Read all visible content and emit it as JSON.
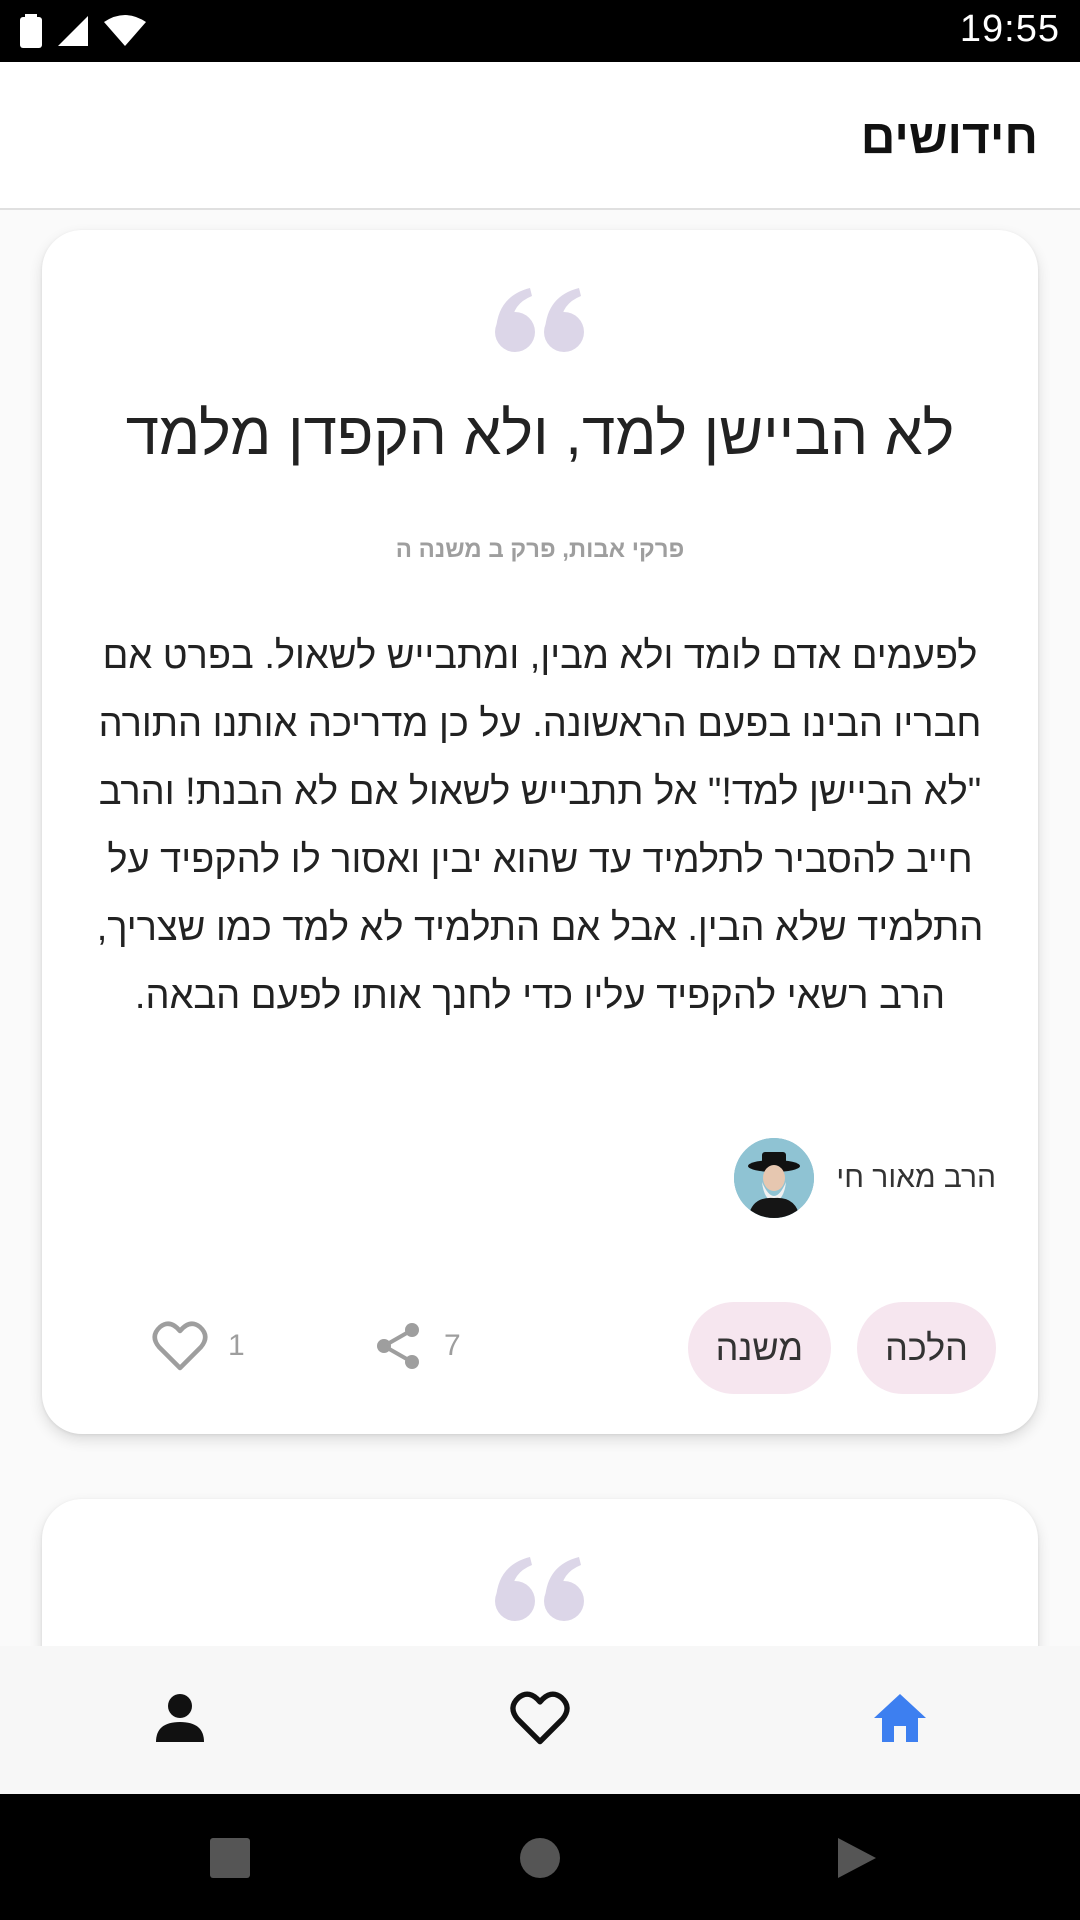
{
  "status_bar": {
    "time": "19:55",
    "icons": [
      "battery-icon",
      "signal-icon",
      "wifi-icon"
    ]
  },
  "app_bar": {
    "title": "חידושים"
  },
  "cards": [
    {
      "title": "לא הביישן למד, ולא הקפדן מלמד",
      "source": "פרקי אבות, פרק ב משנה ה",
      "body": "לפעמים אדם לומד ולא מבין, ומתבייש לשאול. בפרט אם חבריו הבינו בפעם הראשונה. על כן מדריכה אותנו התורה \"לא הביישן למד!\" אל תתבייש לשאול אם לא הבנת! והרב חייב להסביר לתלמיד עד שהוא יבין ואסור לו להקפיד על התלמיד שלא הבין. אבל אם התלמיד לא למד כמו שצריך, הרב רשאי להקפיד עליו כדי לחנך אותו לפעם הבאה.",
      "author": "הרב מאור חי",
      "tags": [
        "הלכה",
        "משנה"
      ],
      "share_count": "7",
      "like_count": "1"
    }
  ],
  "bottom_nav": {
    "items": [
      "profile-icon",
      "favorites-icon",
      "home-icon"
    ],
    "active": "home-icon",
    "active_color": "#3d7ff0"
  },
  "colors": {
    "quote_mark": "#dcd6e8",
    "tag_bg": "#f6e6ef"
  }
}
